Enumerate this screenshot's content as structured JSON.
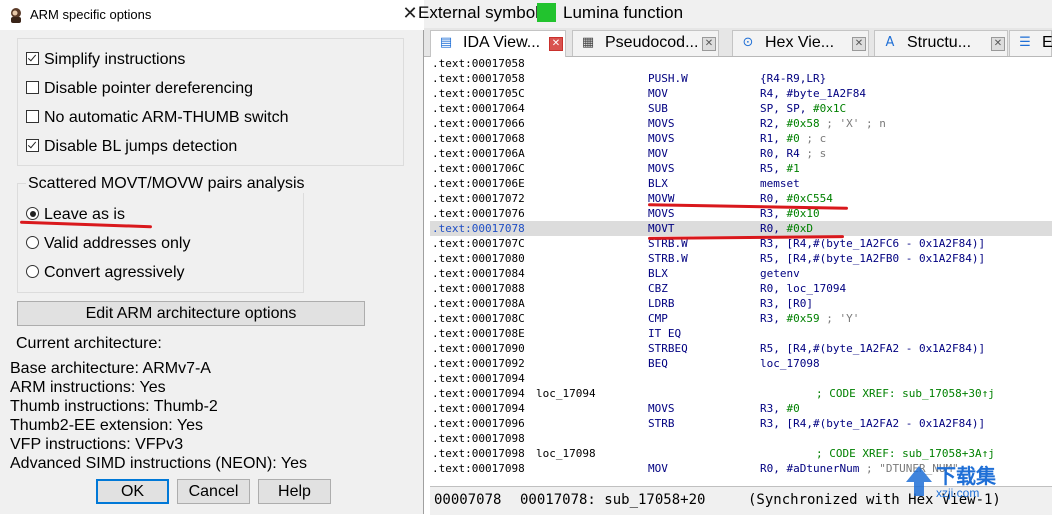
{
  "dialog": {
    "title": "ARM specific options",
    "options": [
      {
        "label": "Simplify instructions",
        "checked": true
      },
      {
        "label": "Disable pointer dereferencing",
        "checked": false
      },
      {
        "label": "No automatic ARM-THUMB switch",
        "checked": false
      },
      {
        "label": "Disable BL jumps detection",
        "checked": true
      }
    ],
    "movt_group": {
      "title": "Scattered MOVT/MOVW pairs analysis",
      "choices": [
        {
          "label": "Leave as is",
          "selected": true
        },
        {
          "label": "Valid addresses only",
          "selected": false
        },
        {
          "label": "Convert agressively",
          "selected": false
        }
      ]
    },
    "edit_button": "Edit ARM architecture options",
    "current_arch_heading": "Current architecture:",
    "arch_info": [
      "Base architecture: ARMv7-A",
      "ARM instructions: Yes",
      "Thumb instructions: Thumb-2",
      "Thumb2-EE extension: Yes",
      "VFP instructions: VFPv3",
      "Advanced SIMD instructions (NEON): Yes"
    ],
    "buttons": {
      "ok": "OK",
      "cancel": "Cancel",
      "help": "Help"
    }
  },
  "legend_bar": {
    "external": "External symbol",
    "lumina": "Lumina function",
    "lumina_color": "#22c32e"
  },
  "tabs": [
    {
      "label": "IDA View...",
      "icon": "ida-view-icon",
      "active": true
    },
    {
      "label": "Pseudocod...",
      "icon": "pseudocode-icon",
      "active": false
    },
    {
      "label": "Hex Vie...",
      "icon": "hex-view-icon",
      "active": false
    },
    {
      "label": "Structu...",
      "icon": "structures-icon",
      "active": false
    },
    {
      "label": "En",
      "icon": "enums-icon",
      "active": false
    }
  ],
  "code": [
    {
      "addr": ".text:00017058",
      "label": "",
      "mn": "",
      "op": ""
    },
    {
      "addr": ".text:00017058",
      "label": "",
      "mn": "PUSH.W",
      "op": "{R4-R9,LR}"
    },
    {
      "addr": ".text:0001705C",
      "label": "",
      "mn": "MOV",
      "op": "R4, #byte_1A2F84"
    },
    {
      "addr": ".text:00017064",
      "label": "",
      "mn": "SUB",
      "op": "SP, SP, #0x1C"
    },
    {
      "addr": ".text:00017066",
      "label": "",
      "mn": "MOVS",
      "op": "R2, #0x58 ; 'X' ; n"
    },
    {
      "addr": ".text:00017068",
      "label": "",
      "mn": "MOVS",
      "op": "R1, #0  ; c"
    },
    {
      "addr": ".text:0001706A",
      "label": "",
      "mn": "MOV",
      "op": "R0, R4  ; s"
    },
    {
      "addr": ".text:0001706C",
      "label": "",
      "mn": "MOVS",
      "op": "R5, #1"
    },
    {
      "addr": ".text:0001706E",
      "label": "",
      "mn": "BLX",
      "op": "memset"
    },
    {
      "addr": ".text:00017072",
      "label": "",
      "mn": "MOVW",
      "op": "R0, #0xC554"
    },
    {
      "addr": ".text:00017076",
      "label": "",
      "mn": "MOVS",
      "op": "R3, #0x10"
    },
    {
      "addr": ".text:00017078",
      "label": "",
      "mn": "MOVT",
      "op": "R0, #0xD",
      "highlight": true
    },
    {
      "addr": ".text:0001707C",
      "label": "",
      "mn": "STRB.W",
      "op": "R3, [R4,#(byte_1A2FC6 - 0x1A2F84)]"
    },
    {
      "addr": ".text:00017080",
      "label": "",
      "mn": "STRB.W",
      "op": "R5, [R4,#(byte_1A2FB0 - 0x1A2F84)]"
    },
    {
      "addr": ".text:00017084",
      "label": "",
      "mn": "BLX",
      "op": "getenv"
    },
    {
      "addr": ".text:00017088",
      "label": "",
      "mn": "CBZ",
      "op": "R0, loc_17094"
    },
    {
      "addr": ".text:0001708A",
      "label": "",
      "mn": "LDRB",
      "op": "R3, [R0]"
    },
    {
      "addr": ".text:0001708C",
      "label": "",
      "mn": "CMP",
      "op": "R3, #0x59 ; 'Y'"
    },
    {
      "addr": ".text:0001708E",
      "label": "",
      "mn": "IT EQ",
      "op": ""
    },
    {
      "addr": ".text:00017090",
      "label": "",
      "mn": "STRBEQ",
      "op": "R5, [R4,#(byte_1A2FA2 - 0x1A2F84)]"
    },
    {
      "addr": ".text:00017092",
      "label": "",
      "mn": "BEQ",
      "op": "loc_17098"
    },
    {
      "addr": ".text:00017094",
      "label": "",
      "mn": "",
      "op": ""
    },
    {
      "addr": ".text:00017094",
      "label": "loc_17094",
      "mn": "",
      "op": "",
      "xref": "; CODE XREF: sub_17058+30↑j"
    },
    {
      "addr": ".text:00017094",
      "label": "",
      "mn": "MOVS",
      "op": "R3, #0"
    },
    {
      "addr": ".text:00017096",
      "label": "",
      "mn": "STRB",
      "op": "R3, [R4,#(byte_1A2FA2 - 0x1A2F84)]"
    },
    {
      "addr": ".text:00017098",
      "label": "",
      "mn": "",
      "op": ""
    },
    {
      "addr": ".text:00017098",
      "label": "loc_17098",
      "mn": "",
      "op": "",
      "xref": "; CODE XREF: sub_17058+3A↑j"
    },
    {
      "addr": ".text:00017098",
      "label": "",
      "mn": "MOV",
      "op": "R0, #aDtunerNum ; \"DTUNER_NUM\""
    }
  ],
  "status": {
    "offset": "00007078",
    "location": "00017078: sub_17058+20",
    "sync": "(Synchronized with Hex View-1)"
  },
  "watermark": {
    "title": "下载集",
    "url": "xzji.com"
  }
}
